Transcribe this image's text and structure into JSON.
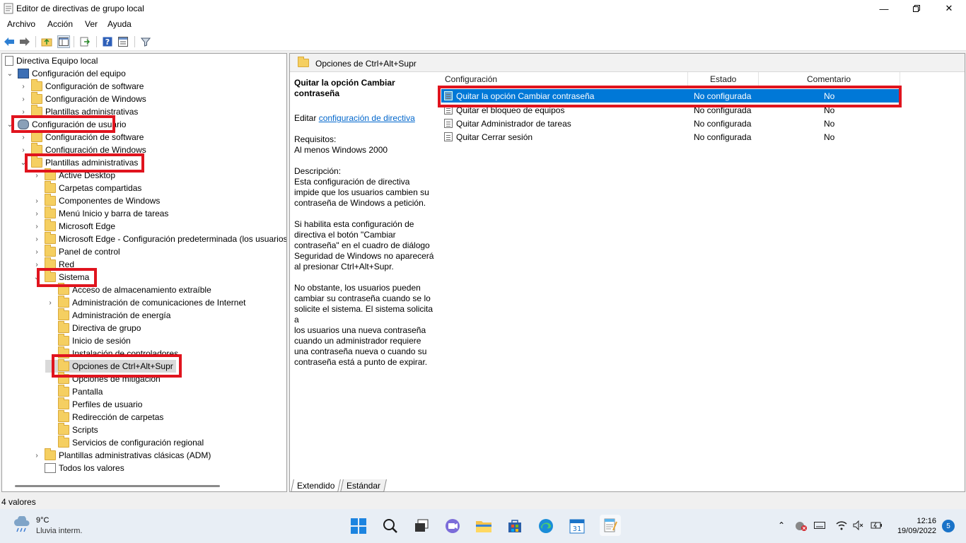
{
  "window": {
    "title": "Editor de directivas de grupo local"
  },
  "menu": [
    "Archivo",
    "Acción",
    "Ver",
    "Ayuda"
  ],
  "toolbar_icons": [
    "back-icon",
    "forward-icon",
    "up-folder-icon",
    "show-hide-tree-icon",
    "export-list-icon",
    "help-icon",
    "properties-icon",
    "filter-icon"
  ],
  "tree": [
    {
      "label": "Directiva Equipo local",
      "icon": "policy-doc-icon"
    },
    {
      "label": "Configuración del equipo",
      "icon": "computer-icon"
    },
    {
      "label": "Configuración de software",
      "icon": "folder-icon"
    },
    {
      "label": "Configuración de Windows",
      "icon": "folder-icon"
    },
    {
      "label": "Plantillas administrativas",
      "icon": "folder-icon"
    },
    {
      "label": "Configuración de usuario",
      "icon": "user-config-icon"
    },
    {
      "label": "Configuración de software",
      "icon": "folder-icon"
    },
    {
      "label": "Configuración de Windows",
      "icon": "folder-icon"
    },
    {
      "label": "Plantillas administrativas",
      "icon": "folder-icon"
    },
    {
      "label": "Active Desktop",
      "icon": "folder-icon"
    },
    {
      "label": "Carpetas compartidas",
      "icon": "folder-icon"
    },
    {
      "label": "Componentes de Windows",
      "icon": "folder-icon"
    },
    {
      "label": "Menú Inicio y barra de tareas",
      "icon": "folder-icon"
    },
    {
      "label": "Microsoft Edge",
      "icon": "folder-icon"
    },
    {
      "label": "Microsoft Edge - Configuración predeterminada (los usuarios",
      "icon": "folder-icon"
    },
    {
      "label": "Panel de control",
      "icon": "folder-icon"
    },
    {
      "label": "Red",
      "icon": "folder-icon"
    },
    {
      "label": "Sistema",
      "icon": "folder-icon"
    },
    {
      "label": "Acceso de almacenamiento extraíble",
      "icon": "folder-icon"
    },
    {
      "label": "Administración de comunicaciones de Internet",
      "icon": "folder-icon"
    },
    {
      "label": "Administración de energía",
      "icon": "folder-icon"
    },
    {
      "label": "Directiva de grupo",
      "icon": "folder-icon"
    },
    {
      "label": "Inicio de sesión",
      "icon": "folder-icon"
    },
    {
      "label": "Instalación de controladores",
      "icon": "folder-icon"
    },
    {
      "label": "Opciones de Ctrl+Alt+Supr",
      "icon": "folder-icon"
    },
    {
      "label": "Opciones de mitigación",
      "icon": "folder-icon"
    },
    {
      "label": "Pantalla",
      "icon": "folder-icon"
    },
    {
      "label": "Perfiles de usuario",
      "icon": "folder-icon"
    },
    {
      "label": "Redirección de carpetas",
      "icon": "folder-icon"
    },
    {
      "label": "Scripts",
      "icon": "folder-icon"
    },
    {
      "label": "Servicios de configuración regional",
      "icon": "folder-icon"
    },
    {
      "label": "Plantillas administrativas clásicas (ADM)",
      "icon": "folder-icon"
    },
    {
      "label": "Todos los valores",
      "icon": "all-settings-icon"
    }
  ],
  "right": {
    "header": "Opciones de Ctrl+Alt+Supr",
    "desc_title": "Quitar la opción Cambiar contraseña",
    "edit_prefix": "Editar ",
    "edit_link": "configuración de directiva",
    "req_label": "Requisitos:",
    "req_value": "Al menos Windows 2000",
    "desc_label": "Descripción:",
    "desc_p1": "Esta configuración de directiva\nimpide que los usuarios cambien su\ncontraseña de Windows a petición.",
    "desc_p2": "Si habilita esta configuración de\ndirectiva el botón \"Cambiar\ncontraseña\" en el cuadro de diálogo\nSeguridad de Windows no aparecerá\nal presionar Ctrl+Alt+Supr.",
    "desc_p3": "No obstante, los usuarios pueden\ncambiar su contraseña cuando se lo\nsolicite el sistema. El sistema solicita a\nlos usuarios una nueva contraseña\ncuando un administrador requiere\nuna contraseña nueva o cuando su\ncontraseña está a punto de expirar.",
    "columns": [
      "Configuración",
      "Estado",
      "Comentario"
    ],
    "rows": [
      {
        "name": "Quitar la opción Cambiar contraseña",
        "state": "No configurada",
        "comment": "No"
      },
      {
        "name": "Quitar el bloqueo de equipos",
        "state": "No configurada",
        "comment": "No"
      },
      {
        "name": "Quitar Administrador de tareas",
        "state": "No configurada",
        "comment": "No"
      },
      {
        "name": "Quitar Cerrar sesión",
        "state": "No configurada",
        "comment": "No"
      }
    ],
    "tabs": [
      "Extendido",
      "Estándar"
    ]
  },
  "status": "4 valores",
  "taskbar": {
    "weather_temp": "9°C",
    "weather_cond": "Lluvia interm.",
    "time": "12:16",
    "date": "19/09/2022",
    "notif_count": "5",
    "apps": [
      "windows-start-icon",
      "search-icon",
      "task-view-icon",
      "chat-icon",
      "file-explorer-icon",
      "store-icon",
      "edge-icon",
      "calendar-icon",
      "notepad-icon"
    ],
    "calendar_day": "31"
  },
  "colors": {
    "selection": "#0078d7",
    "highlight": "#e0141e"
  }
}
